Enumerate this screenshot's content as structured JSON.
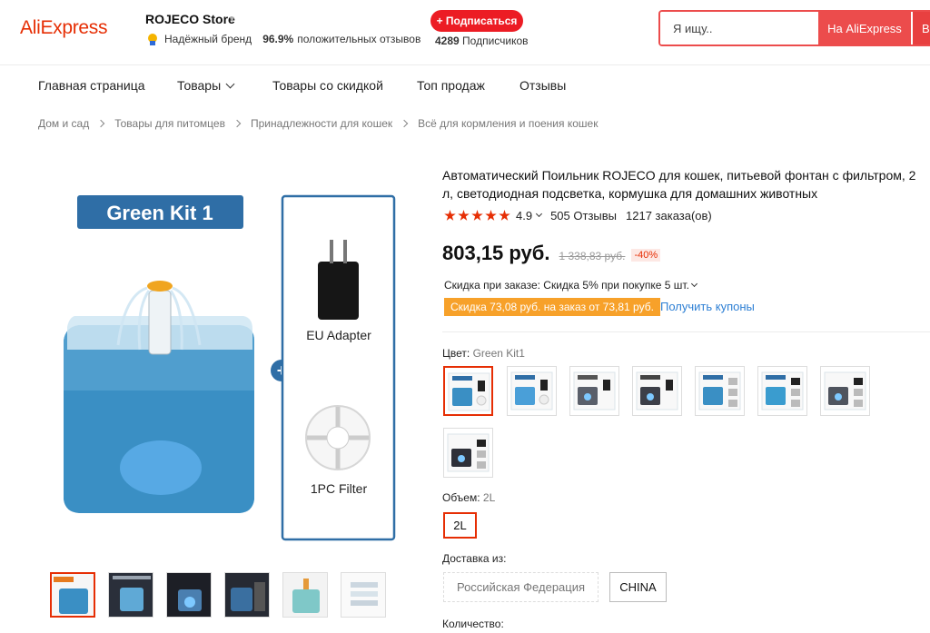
{
  "header": {
    "logo": "AliExpress",
    "store_name": "ROJECO Store",
    "trust_label": "Надёжный бренд",
    "trust_percent": "96.9%",
    "trust_suffix": "положительных отзывов",
    "subscribe_label": "+ Подписаться",
    "subscribers_count": "4289",
    "subscribers_label": "Подписчиков",
    "search_placeholder": "Я ищу..",
    "search_aliexpress_label": "На AliExpress",
    "search_store_label": "В"
  },
  "nav": {
    "items": [
      "Главная страница",
      "Товары",
      "Товары со скидкой",
      "Топ продаж",
      "Отзывы"
    ]
  },
  "breadcrumb": [
    "Дом и сад",
    "Товары для питомцев",
    "Принадлежности для кошек",
    "Всё для кормления и поения кошек"
  ],
  "gallery": {
    "banner": "Green Kit 1",
    "adapter_label": "EU Adapter",
    "filter_label": "1PC Filter",
    "thumb_count": 6
  },
  "product": {
    "title": "Автоматический Поильник ROJECO для кошек, питьевой фонтан с фильтром, 2 л, светодиодная подсветка, кормушка для домашних животных",
    "rating": "4.9",
    "stars": 5,
    "reviews": "505 Отзывы",
    "orders": "1217 заказа(ов)",
    "price": "803,15 руб.",
    "old_price": "1 338,83 руб.",
    "discount": "-40%",
    "order_discount": "Скидка при заказе: Скидка 5% при покупке 5 шт.",
    "coupon_tag": "Скидка 73,08 руб. на заказ от 73,81 руб.",
    "coupon_link": "Получить купоны"
  },
  "options": {
    "color_label": "Цвет:",
    "color_value": "Green Kit1",
    "colors": [
      "blue-green-kit1",
      "blue-kit",
      "grey-kit",
      "black-kit",
      "blue-kit-2",
      "blue-kit-3",
      "grey-kit-2",
      "black-kit-2"
    ],
    "volume_label": "Объем:",
    "volume_value": "2L",
    "volume_options": [
      "2L"
    ],
    "ship_label": "Доставка из:",
    "ship_options": [
      "Российская Федерация",
      "CHINA"
    ],
    "quantity_label": "Количество:"
  },
  "colors": {
    "brand": "#e62e04",
    "accent_red": "#ec4c4c",
    "coupon": "#f7a12a",
    "link": "#2d7fd4",
    "product_blue": "#3a8fc4"
  }
}
